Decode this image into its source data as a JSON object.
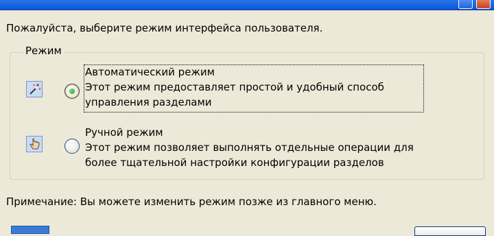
{
  "dialog": {
    "prompt": "Пожалуйста, выберите режим интерфейса пользователя."
  },
  "group": {
    "legend": "Режим"
  },
  "options": [
    {
      "title": "Автоматический режим",
      "description_line1": "Этот режим предоставляет простой и удобный способ",
      "description_line2": "управления разделами",
      "selected": true,
      "icon": "magic-wand-icon"
    },
    {
      "title": "Ручной режим",
      "description_line1": "Этот режим позволяет выполнять отдельные операции для",
      "description_line2": "более тщательной настройки конфигурации разделов",
      "selected": false,
      "icon": "hand-pointer-icon"
    }
  ],
  "note": "Примечание: Вы можете изменить режим позже из главного меню.",
  "colors": {
    "dialog_background": "#ece9d8",
    "titlebar": "#0a56d6",
    "radio_selected": "#21a121"
  }
}
